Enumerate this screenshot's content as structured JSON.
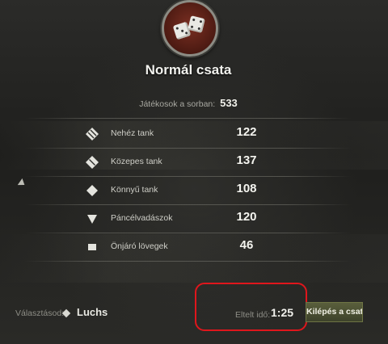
{
  "battle": {
    "title": "Normál csata",
    "queue_label": "Játékosok a sorban:",
    "queue_total": "533"
  },
  "tank_classes": [
    {
      "icon": "heavy-tank-icon",
      "label": "Nehéz tank",
      "count": "122"
    },
    {
      "icon": "medium-tank-icon",
      "label": "Közepes tank",
      "count": "137"
    },
    {
      "icon": "light-tank-icon",
      "label": "Könnyű tank",
      "count": "108"
    },
    {
      "icon": "tank-destroyer-icon",
      "label": "Páncélvadászok",
      "count": "120"
    },
    {
      "icon": "spg-icon",
      "label": "Önjáró lövegek",
      "count": "46"
    }
  ],
  "selection": {
    "label": "Választásod:",
    "tank_icon": "light-tank-icon",
    "tank_name": "Luchs"
  },
  "timer": {
    "label": "Eltelt idő:",
    "value": "1:25"
  },
  "actions": {
    "leave_label": "Kilépés a csatá"
  },
  "colors": {
    "highlight": "#e0161c",
    "emblem": "#7a2f22",
    "button": "#4b5033"
  }
}
